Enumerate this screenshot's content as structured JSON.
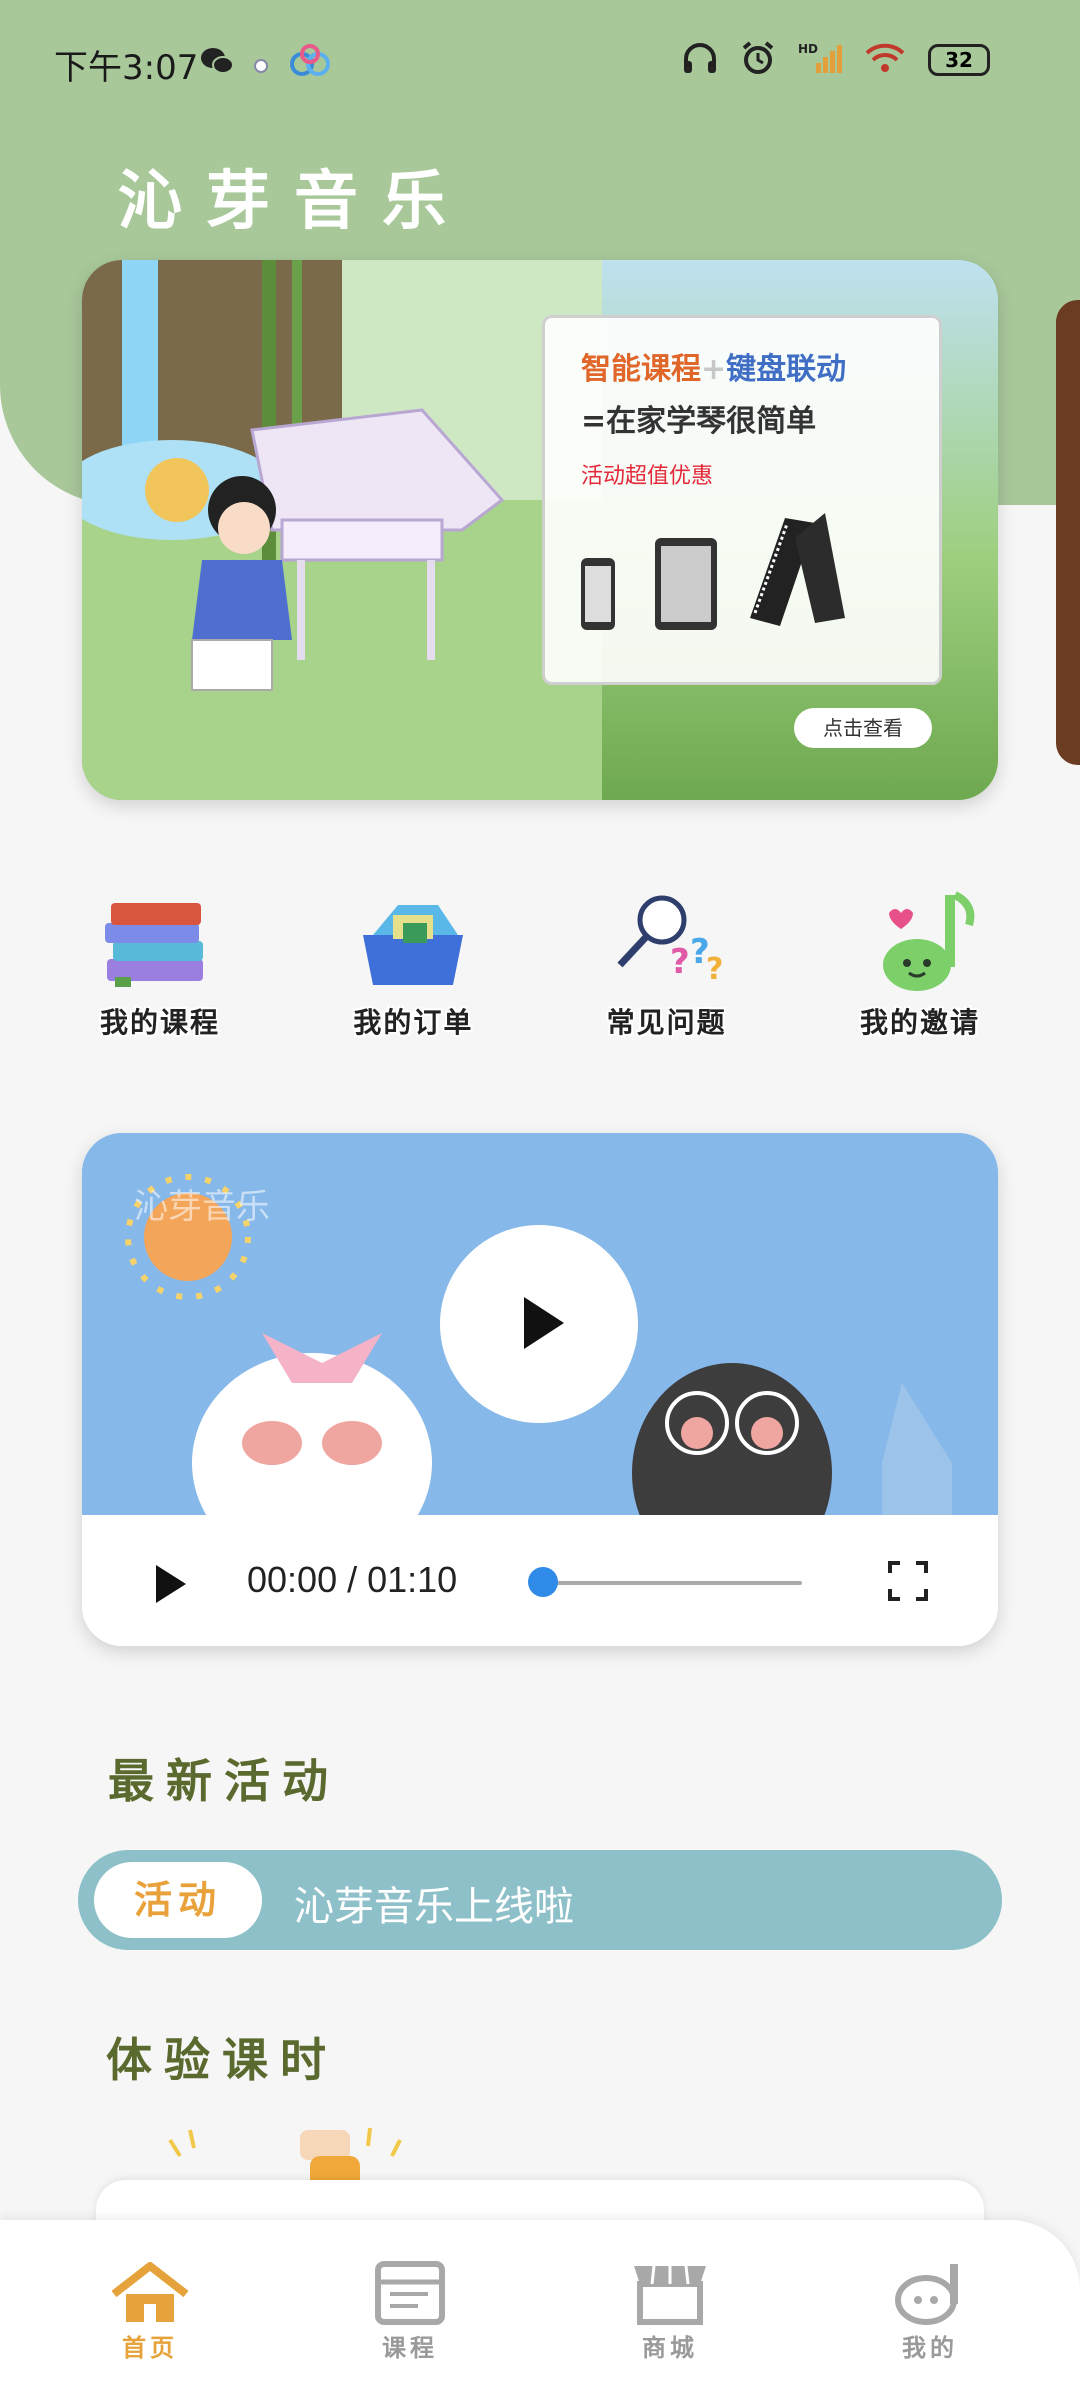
{
  "status_bar": {
    "time": "下午3:07",
    "battery": "32"
  },
  "app": {
    "title": "沁芽音乐"
  },
  "banner": {
    "promo_line1_a": "智能课程",
    "promo_line1_plus": "+",
    "promo_line1_b": "键盘联动",
    "promo_line2": "=在家学琴很简单",
    "promo_line3": "活动超值优惠",
    "view_button": "点击查看"
  },
  "quick_entries": [
    {
      "label": "我的课程",
      "icon": "books-icon"
    },
    {
      "label": "我的订单",
      "icon": "order-box-icon"
    },
    {
      "label": "常见问题",
      "icon": "faq-magnifier-icon"
    },
    {
      "label": "我的邀请",
      "icon": "music-note-icon"
    }
  ],
  "video": {
    "watermark": "沁芽音乐",
    "time_display": "00:00 / 01:10",
    "progress": 0.0
  },
  "sections": {
    "latest_activity": "最新活动",
    "trial_lessons": "体验课时"
  },
  "activity": {
    "tag": "活动",
    "text": "沁芽音乐上线啦"
  },
  "bottom_nav": [
    {
      "label": "首页",
      "icon": "home-icon",
      "active": true
    },
    {
      "label": "课程",
      "icon": "course-icon",
      "active": false
    },
    {
      "label": "商城",
      "icon": "shop-icon",
      "active": false
    },
    {
      "label": "我的",
      "icon": "profile-icon",
      "active": false
    }
  ],
  "colors": {
    "header_green": "#a8c89a",
    "activity_bar": "#8dc0c8",
    "active_nav": "#e6a33b",
    "progress_knob": "#2f8ae8"
  }
}
